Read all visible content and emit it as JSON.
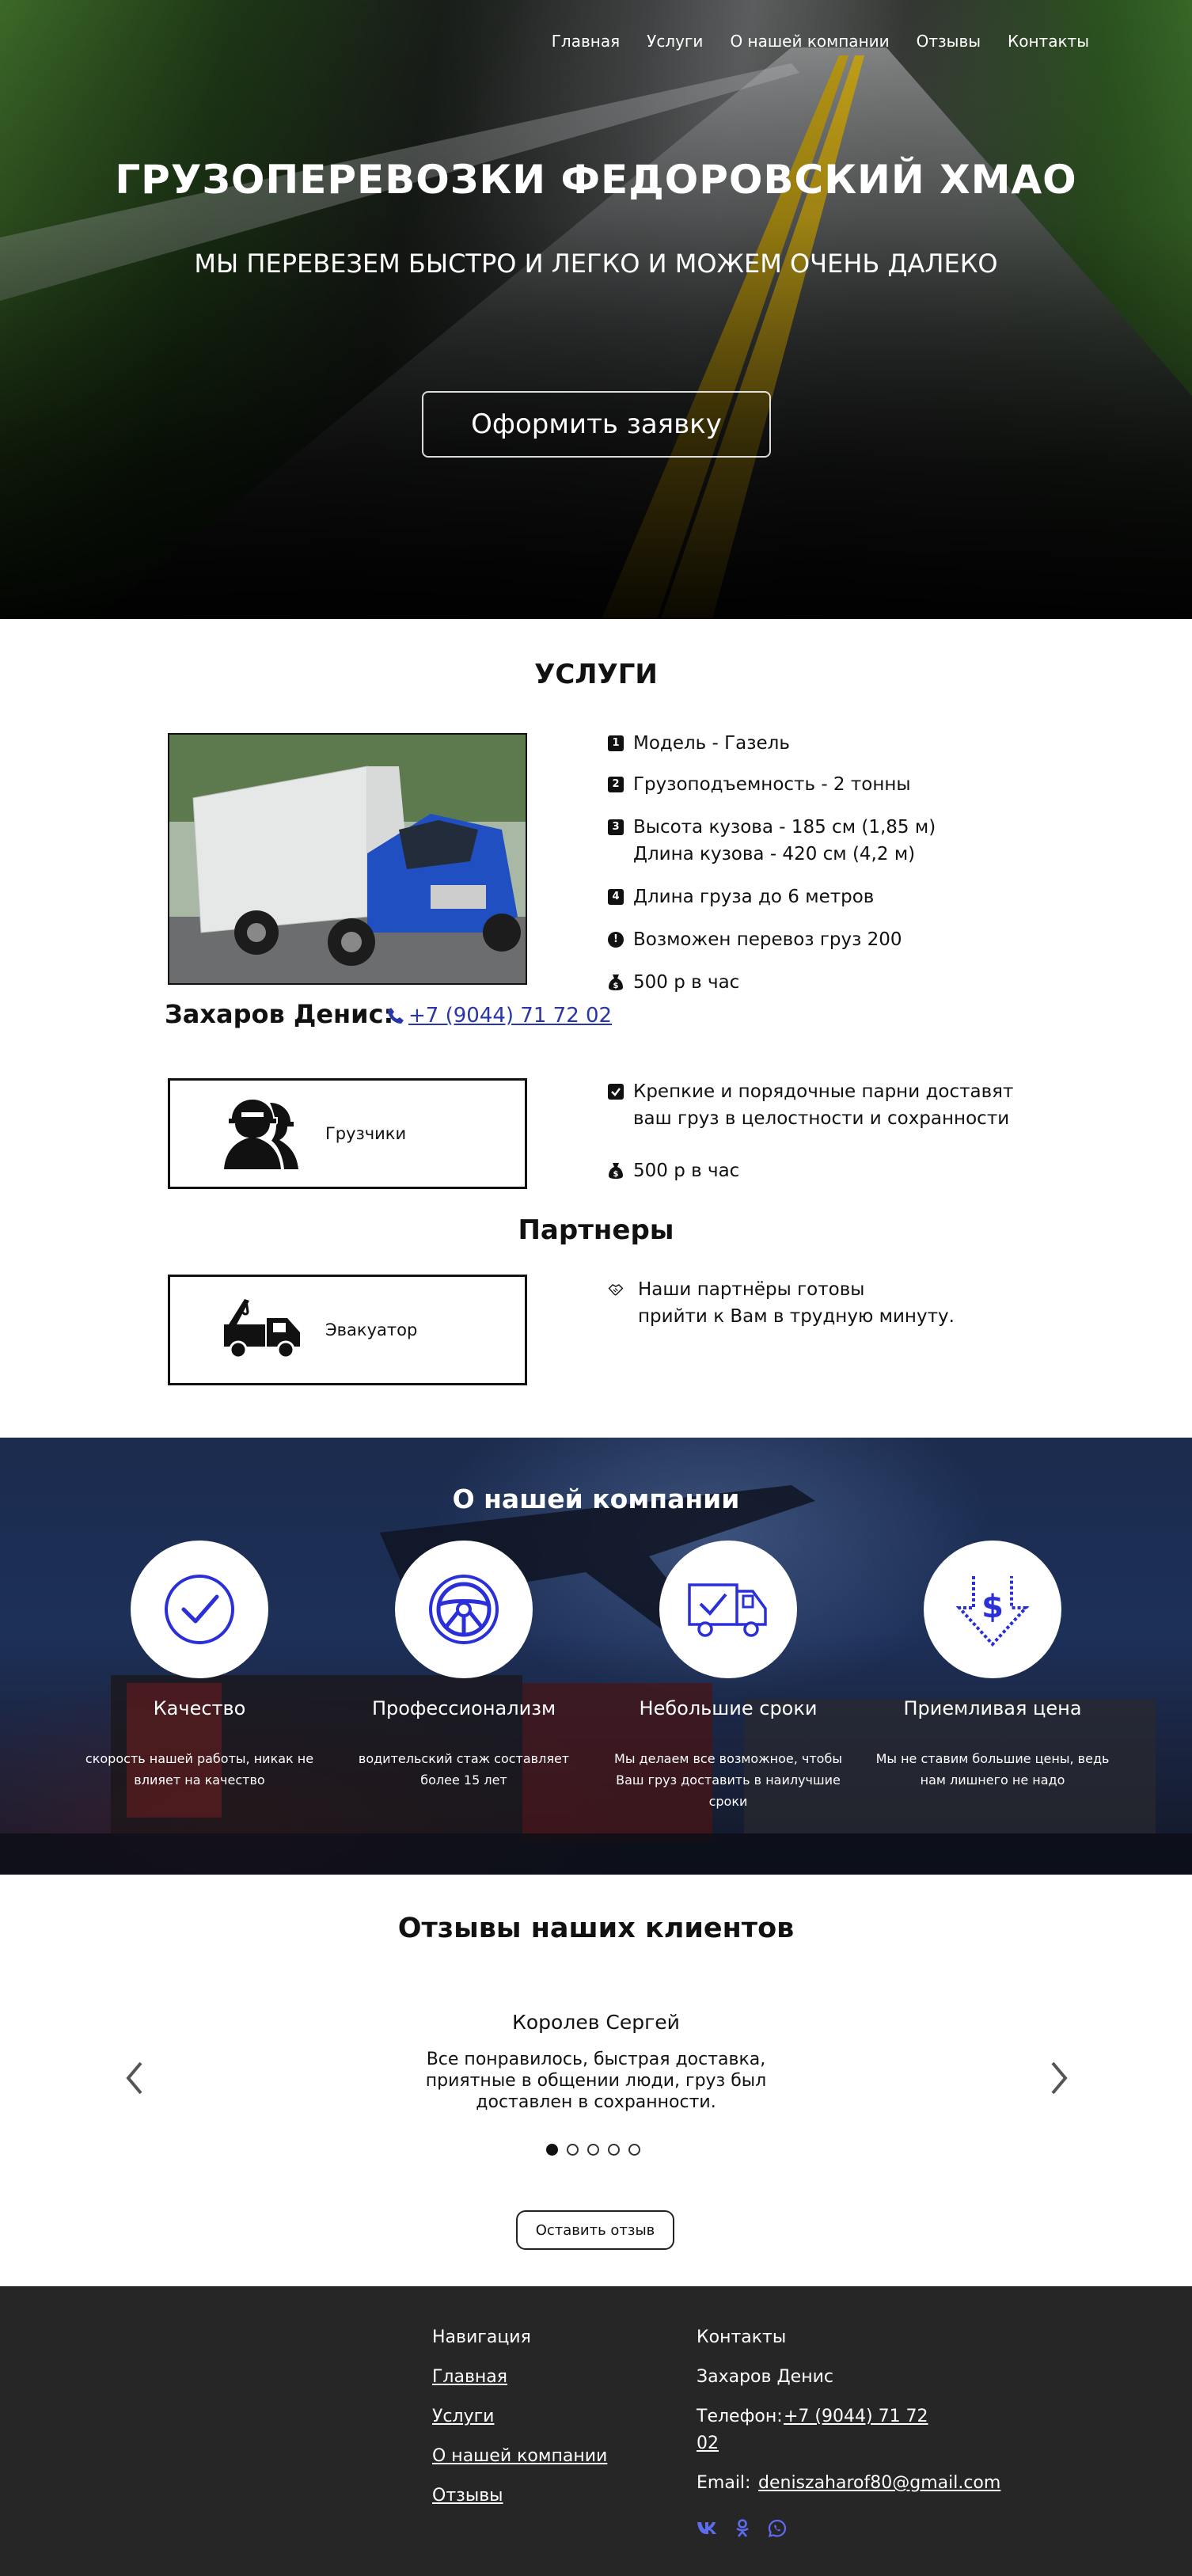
{
  "nav": [
    "Главная",
    "Услуги",
    "О нашей компании",
    "Отзывы",
    "Контакты"
  ],
  "hero": {
    "title": "ГРУЗОПЕРЕВОЗКИ ФЕДОРОВСКИЙ ХМАО",
    "subtitle": "МЫ ПЕРЕВЕЗЕМ БЫСТРО И ЛЕГКО И МОЖЕМ ОЧЕНЬ ДАЛЕКО",
    "button": "Оформить заявку"
  },
  "services": {
    "title": "УСЛУГИ",
    "owner": "Захаров Денис:",
    "phone": "+7 (9044) 71 72 02",
    "specs": [
      {
        "icon": "1",
        "text": "Модель - Газель"
      },
      {
        "icon": "2",
        "text": "Грузоподъемность - 2 тонны"
      },
      {
        "icon": "3",
        "text": "Высота кузова - 185 см (1,85 м)",
        "text2": "Длина кузова - 420 см (4,2 м)"
      },
      {
        "icon": "4",
        "text": "Длина груза до 6 метров"
      },
      {
        "icon": "!",
        "text": "Возможен перевоз груз 200"
      },
      {
        "icon": "money-bag-icon",
        "text": "500 р в час"
      }
    ],
    "movers_label": "Грузчики",
    "movers_text1": "Крепкие и порядочные парни доставят",
    "movers_text2": "ваш груз в целостности и сохранности",
    "movers_price": "500 р в час",
    "partners_title": "Партнеры",
    "tow_label": "Эвакуатор",
    "partners_text1": "Наши партнёры готовы",
    "partners_text2": "прийти к Вам в трудную минуту."
  },
  "about": {
    "title": "О нашей компании",
    "features": [
      {
        "icon": "checkmark-icon",
        "title": "Качество",
        "desc": "скорость нашей работы, никак не влияет на качество"
      },
      {
        "icon": "steering-wheel-icon",
        "title": "Профессионализм",
        "desc": "водительский стаж составляет более 15 лет"
      },
      {
        "icon": "delivery-truck-icon",
        "title": "Небольшие сроки",
        "desc": "Мы делаем все возможное, чтобы Ваш груз доставить в наилучшие сроки"
      },
      {
        "icon": "dollar-down-icon",
        "title": "Приемливая цена",
        "desc": "Мы не ставим большие цены, ведь нам лишнего не надо"
      }
    ]
  },
  "reviews": {
    "title": "Отзывы наших клиентов",
    "name": "Королев Сергей",
    "text": "Все понравилось, быстрая доставка, приятные в общении люди, груз был доставлен в сохранности.",
    "active_slide": 1,
    "slide_count": 5,
    "leave_button": "Оставить отзыв"
  },
  "footer": {
    "nav_title": "Навигация",
    "nav_links": [
      "Главная",
      "Услуги",
      "О нашей компании",
      "Отзывы"
    ],
    "contacts_title": "Контакты",
    "contact_name": "Захаров Денис",
    "phone_label": "Телефон:",
    "phone_line1": "+7 (9044) 71 72",
    "phone_line2": "02",
    "email_label": "Email:",
    "email": "deniszaharof80@gmail.com",
    "social": [
      "vk-icon",
      "odnoklassniki-icon",
      "whatsapp-icon"
    ]
  },
  "colors": {
    "accent_blue": "#2a2fd8",
    "link_blue": "#2a35a8",
    "footer_bg": "#262626",
    "social_icon": "#5b6cf0"
  }
}
